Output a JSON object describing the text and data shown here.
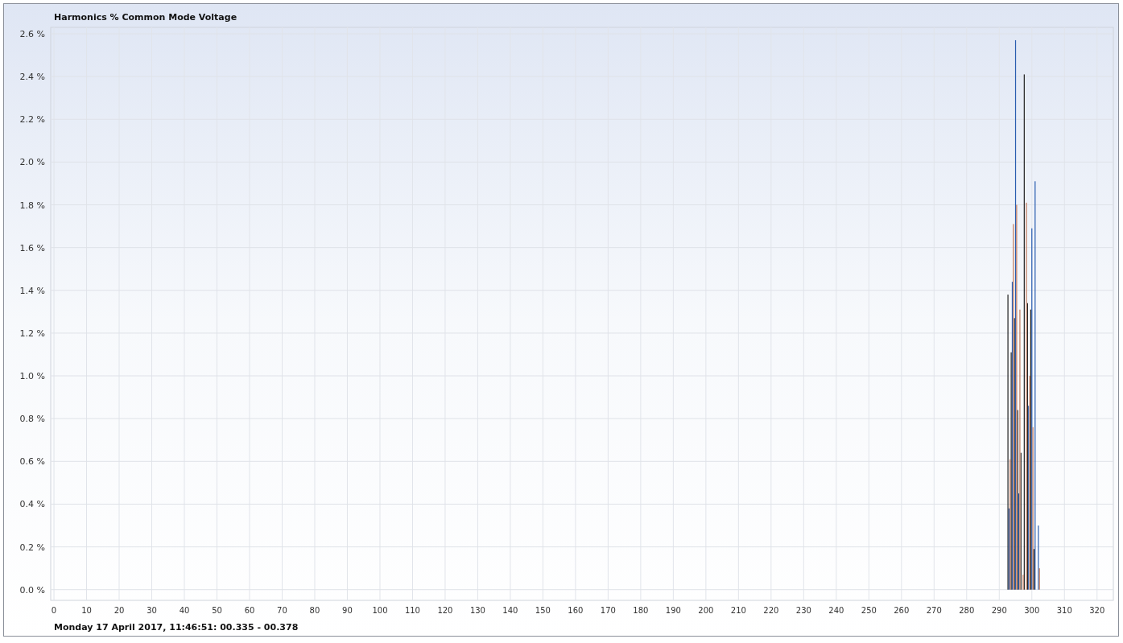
{
  "chart": {
    "chart_data": {
      "type": "bar",
      "title": "Harmonics % Common Mode Voltage",
      "grid": true,
      "x": [
        293,
        294,
        295,
        296,
        297,
        298,
        299,
        300,
        301,
        302
      ],
      "series": [
        {
          "color": "#1f1f1f",
          "values": [
            1.38,
            1.11,
            1.27,
            0.84,
            0.64,
            2.41,
            1.34,
            1.31,
            0.19,
            null
          ]
        },
        {
          "color": "#2a5db0",
          "values": [
            0.38,
            1.44,
            2.57,
            0.45,
            null,
            null,
            0.86,
            1.69,
            1.91,
            0.3
          ]
        },
        {
          "color": "#c0785a",
          "values": [
            0.61,
            1.71,
            1.8,
            1.31,
            0.07,
            1.81,
            1.0,
            0.76,
            null,
            0.1
          ]
        }
      ],
      "xlim": [
        -1,
        325
      ],
      "ylim": [
        -0.05,
        2.63
      ],
      "xticks": [
        0,
        10,
        20,
        30,
        40,
        50,
        60,
        70,
        80,
        90,
        100,
        110,
        120,
        130,
        140,
        150,
        160,
        170,
        180,
        190,
        200,
        210,
        220,
        230,
        240,
        250,
        260,
        270,
        280,
        290,
        300,
        310,
        320
      ],
      "yticks": [
        {
          "value": 0,
          "label": "0.0 %"
        },
        {
          "value": 0.2,
          "label": "0.2 %"
        },
        {
          "value": 0.4,
          "label": "0.4 %"
        },
        {
          "value": 0.6,
          "label": "0.6 %"
        },
        {
          "value": 0.8,
          "label": "0.8 %"
        },
        {
          "value": 1.0,
          "label": "1.0 %"
        },
        {
          "value": 1.2,
          "label": "1.2 %"
        },
        {
          "value": 1.4,
          "label": "1.4 %"
        },
        {
          "value": 1.6,
          "label": "1.6 %"
        },
        {
          "value": 1.8,
          "label": "1.8 %"
        },
        {
          "value": 2.0,
          "label": "2.0 %"
        },
        {
          "value": 2.2,
          "label": "2.2 %"
        },
        {
          "value": 2.4,
          "label": "2.4 %"
        },
        {
          "value": 2.6,
          "label": "2.6 %"
        }
      ]
    }
  },
  "footer": "Monday 17 April 2017, 11:46:51: 00.335 - 00.378"
}
